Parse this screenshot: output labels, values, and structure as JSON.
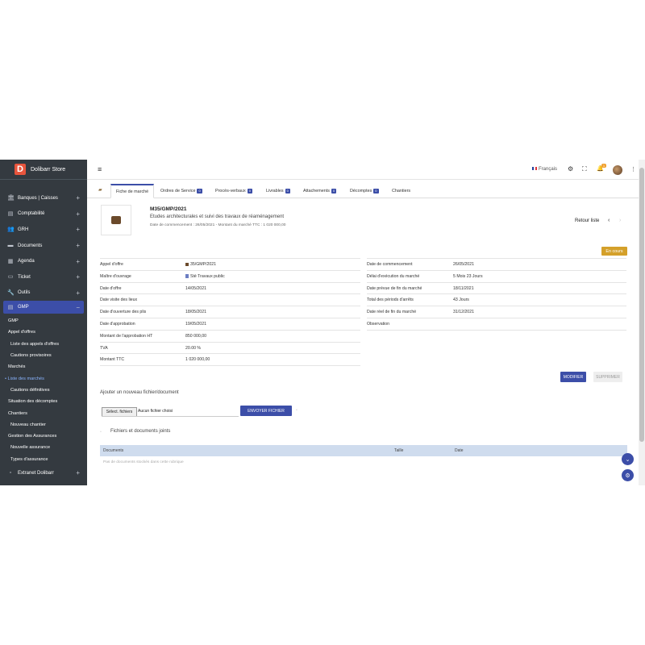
{
  "brand": {
    "logo_letter": "D",
    "name": "Dolibarr Store"
  },
  "sidebar": {
    "items": [
      {
        "label": "Banques | Caisses",
        "icon": "bank-icon",
        "glyph": "🏛"
      },
      {
        "label": "Comptabilité",
        "icon": "accounting-icon",
        "glyph": "▤"
      },
      {
        "label": "GRH",
        "icon": "users-icon",
        "glyph": "👥"
      },
      {
        "label": "Documents",
        "icon": "folder-icon",
        "glyph": "▬"
      },
      {
        "label": "Agenda",
        "icon": "calendar-icon",
        "glyph": "▦"
      },
      {
        "label": "Ticket",
        "icon": "ticket-icon",
        "glyph": "▭"
      },
      {
        "label": "Outils",
        "icon": "wrench-icon",
        "glyph": "🔧"
      },
      {
        "label": "GMP",
        "icon": "gmp-icon",
        "glyph": "▤"
      }
    ],
    "plus": "+",
    "minus": "−",
    "sub": [
      "GMP",
      "Appel d'offres",
      "Liste des appels d'offres",
      "Cautions provisoires",
      "Marchés",
      "Liste des marchés",
      "Cautions définitives",
      "Situation des décomptes",
      "Chantiers",
      "Nouveau chantier",
      "Gestion des Assurances",
      "Nouvelle assurance",
      "Types d'assurance"
    ],
    "current_bullet": "•",
    "extranet": "Extranet Dolibarr"
  },
  "topbar": {
    "menu_icon": "≡",
    "language": "Français",
    "notif_count": "1",
    "gear": "⚙",
    "fullscreen": "⛶",
    "bell": "🔔",
    "kebab": "⋮"
  },
  "tabs": [
    {
      "label": "Fiche de marché",
      "badge": ""
    },
    {
      "label": "Ordres de Service",
      "badge": "0"
    },
    {
      "label": "Procès-verbaux",
      "badge": "0"
    },
    {
      "label": "Livrables",
      "badge": "0"
    },
    {
      "label": "Attachements",
      "badge": "0"
    },
    {
      "label": "Décomptes",
      "badge": "0"
    },
    {
      "label": "Chantiers",
      "badge": ""
    }
  ],
  "header": {
    "ref": "M35/GMP/2021",
    "label": "Etudes architecturales et suivi des travaux de réaménagement",
    "dates": "Date de commencement : 26/05/2021 - Montant du marché TTC : 1 020 000,00",
    "retour": "Retour liste",
    "prev": "‹",
    "next": "›",
    "status": "En cours"
  },
  "left_fields": [
    {
      "key": "Appel d'offre",
      "value": "35/GMP/2021"
    },
    {
      "key": "Maître d'ouvrage",
      "value": "Sté Travaux public"
    },
    {
      "key": "Date d'offre",
      "value": "14/05/2021"
    },
    {
      "key": "Date visite des lieux",
      "value": ""
    },
    {
      "key": "Date d'ouverture des plis",
      "value": "18/05/2021"
    },
    {
      "key": "Date d'approbation",
      "value": "19/05/2021"
    },
    {
      "key": "Montant de l'approbation HT",
      "value": "850 000,00"
    },
    {
      "key": "TVA",
      "value": "20.00 %"
    },
    {
      "key": "Montant TTC",
      "value": "1 020 000,00"
    }
  ],
  "right_fields": [
    {
      "key": "Date de commencement",
      "value": "26/05/2021"
    },
    {
      "key": "Délai d'exécution du marché",
      "value": "5 Mois 23 Jours"
    },
    {
      "key": "Date prévue de fin du marché",
      "value": "18/11/2021"
    },
    {
      "key": "Total des périods d'arrêts",
      "value": "43 Jours"
    },
    {
      "key": "Date réel de fin du marché",
      "value": "31/12/2021"
    },
    {
      "key": "Observation",
      "value": ""
    }
  ],
  "actions": {
    "modifier": "MODIFIER",
    "supprimer": "SUPPRIMER"
  },
  "upload": {
    "title": "Ajouter un nouveau fichier/document",
    "select": "Sélect. fichiers",
    "none": "Aucun fichier choisi",
    "send": "ENVOYER FICHIER"
  },
  "joints": {
    "title": "Fichiers et documents joints",
    "cols": [
      "Documents",
      "Taille",
      "Date"
    ],
    "empty": "Pas de documents stockés dans cette rubrique"
  },
  "colors": {
    "sidebar": "#343a40",
    "primary": "#3c4ea8",
    "status": "#d4a02a",
    "table_head": "#cfdcee"
  }
}
